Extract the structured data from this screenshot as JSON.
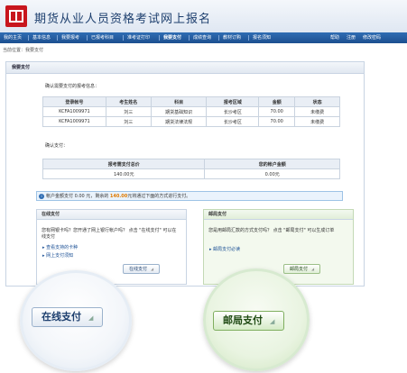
{
  "header": {
    "title": "期货从业人员资格考试网上报名"
  },
  "nav": {
    "items": [
      "我的主页",
      "基本信息",
      "我要报考",
      "已报考科目",
      "准考证打印",
      "我要支付",
      "成绩查询",
      "教材订购",
      "报名须知"
    ],
    "active_index": 5,
    "right_items": [
      "帮助",
      "注册",
      "修改密码"
    ]
  },
  "breadcrumb": "当前位置：我要支付",
  "panel": {
    "title": "我要支付",
    "confirm_label": "确认需要支付的报考信息：",
    "table": {
      "headers": [
        "登录帐号",
        "考生姓名",
        "科目",
        "报考区域",
        "金额",
        "状态"
      ],
      "rows": [
        [
          "KCFA1009971",
          "刘三",
          "期货基础知识",
          "长沙考区",
          "70.00",
          "未缴费"
        ],
        [
          "KCFA1009971",
          "刘三",
          "期货法律法规",
          "长沙考区",
          "70.00",
          "未缴费"
        ]
      ]
    },
    "confirm_pay_label": "确认支付：",
    "summary": {
      "headers": [
        "报考需支付总价",
        "您的帐户金额"
      ],
      "values": [
        "140.00元",
        "0.00元"
      ]
    },
    "notice": {
      "prefix": "帐户金额支付 0.00 元，剩余的 ",
      "amount": "140.00",
      "suffix": "元将通过下面的方式进行支付。",
      "icon": "info-icon"
    },
    "online": {
      "title": "在线支付",
      "desc": "您有网银卡吗？您开通了网上银行帐户吗？ 点击 \"在线支付\" 可以在线支付",
      "links": [
        "查看支持的卡种",
        "网上支付须知"
      ],
      "button": "在线支付"
    },
    "post": {
      "title": "邮局支付",
      "desc": "您是用邮局汇款的方式支付吗？ 点击 \"邮局支付\" 可以生成订单",
      "links": [
        "邮局支付必读"
      ],
      "button": "邮局支付"
    }
  },
  "magnifier": {
    "online_button": "在线支付",
    "post_button": "邮局支付"
  },
  "colors": {
    "brand_red": "#c8161d",
    "nav_blue": "#1c4f8f",
    "accent_orange": "#e07a00"
  }
}
